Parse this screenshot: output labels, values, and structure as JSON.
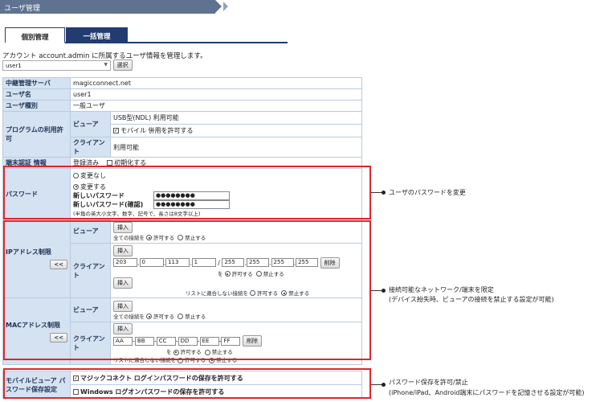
{
  "title": "ユーザ管理",
  "tabs": [
    {
      "label": "個別管理",
      "active": true
    },
    {
      "label": "一括管理",
      "active": false
    }
  ],
  "description": "アカウント account.admin に所属するユーザ情報を管理します。",
  "user_select": {
    "value": "user1",
    "button": "選択"
  },
  "rows": {
    "relay_server": {
      "label": "中継管理サーバ",
      "value": "magicconnect.net"
    },
    "username": {
      "label": "ユーザ名",
      "value": "user1"
    },
    "user_type": {
      "label": "ユーザ種別",
      "value": "一般ユーザ"
    },
    "program": {
      "label": "プログラムの利用許可",
      "viewer_label": "ビューア",
      "viewer_value": "USB型(NDL) 利用可能",
      "mobile_check": "モバイル 併用を許可する",
      "client_label": "クライアント",
      "client_value": "利用可能"
    },
    "terminal": {
      "label": "端末認証 情報",
      "status": "登録済み",
      "init": "初期化する"
    },
    "password": {
      "label": "パスワード",
      "no_change": "変更なし",
      "change": "変更する",
      "new_label": "新しいパスワード",
      "confirm_label": "新しいパスワード(確認)",
      "new_value": "●●●●●●●●",
      "confirm_value": "●●●●●●●●",
      "hint": "(半角の英大小文字、数字、記号で、長さは8文字以上)"
    },
    "ip": {
      "label": "IPアドレス制限",
      "arrow_btn": "<<",
      "viewer_label": "ビューア",
      "insert": "挿入",
      "all_conn": "全ての接続を",
      "allow": "許可する",
      "deny": "禁止する",
      "client_label": "クライアント",
      "ip_from": [
        "203",
        "0",
        "113",
        "1"
      ],
      "slash": "/",
      "ip_mask": [
        "255",
        "255",
        "255",
        "255"
      ],
      "delete": "削除",
      "wo": "を",
      "nomatch": "リストに適合しない接続を"
    },
    "mac": {
      "label": "MACアドレス制限",
      "arrow_btn": "<<",
      "viewer_label": "ビューア",
      "insert": "挿入",
      "all_conn": "全ての接続を",
      "allow": "許可する",
      "deny": "禁止する",
      "client_label": "クライアント",
      "mac": [
        "AA",
        "BB",
        "CC",
        "DD",
        "EE",
        "FF"
      ],
      "delete": "削除",
      "wo": "を",
      "nomatch": "リストに適合しない接続を"
    },
    "mobile": {
      "label": "モバイルビューア パスワード保存設定",
      "opt1": "マジックコネクト ログインパスワードの保存を許可する",
      "opt2": "Windows ログオンパスワードの保存を許可する"
    }
  },
  "notes": {
    "password": "ユーザのパスワードを変更",
    "network_1": "接続可能なネットワーク/端末を限定",
    "network_2": "(デバイス紛失時、ビューアの接続を禁止する設定が可能)",
    "mobile_1": "パスワード保存を許可/禁止",
    "mobile_2": "(iPhone/iPad、Android端末にパスワードを記憶させる設定が可能)"
  },
  "colors": {
    "header": "#5f7390",
    "tab_active_border": "#233c70",
    "label_bg": "#d5e2f1",
    "highlight": "#e0262d"
  }
}
